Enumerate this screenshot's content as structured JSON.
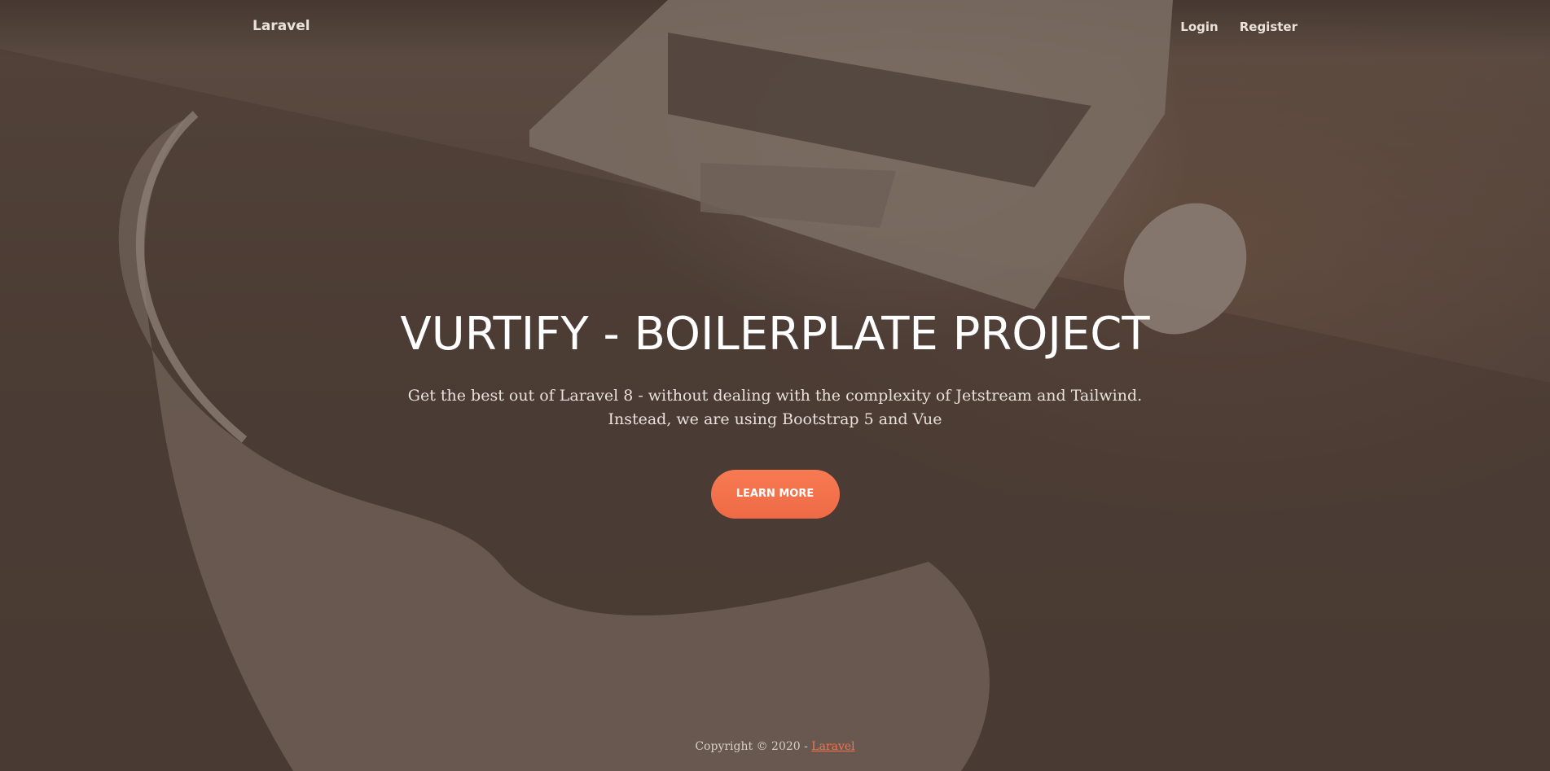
{
  "navbar": {
    "brand": "Laravel",
    "links": [
      {
        "label": "Login"
      },
      {
        "label": "Register"
      }
    ]
  },
  "hero": {
    "title": "VURTIFY - BOILERPLATE PROJECT",
    "subtitle": "Get the best out of Laravel 8 - without dealing with the complexity of Jetstream and Tailwind. Instead, we are using Bootstrap 5 and Vue",
    "cta_label": "LEARN MORE"
  },
  "footer": {
    "copyright": "Copyright © 2020 - ",
    "link_label": "Laravel"
  },
  "colors": {
    "overlay": "#4f4038",
    "accent": "#f3734d",
    "text": "#ffffff"
  }
}
